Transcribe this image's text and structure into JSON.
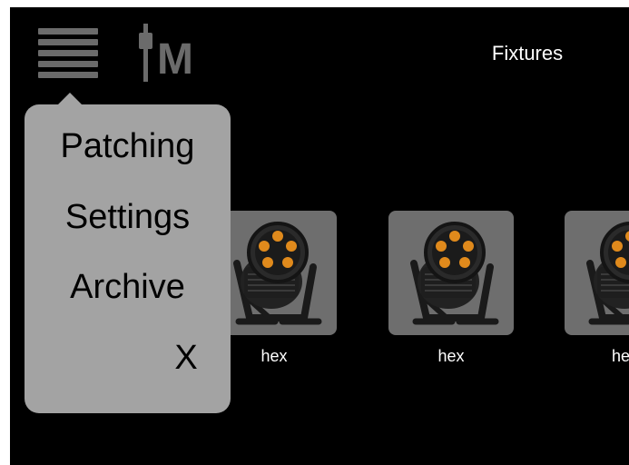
{
  "header": {
    "title": "Fixtures",
    "menu_icon": "hamburger-menu-icon",
    "logo_icon": "fader-m-logo",
    "logo_letter": "M"
  },
  "fixtures": [
    {
      "label": "hex",
      "icon": "par-light-fixture"
    },
    {
      "label": "hex",
      "icon": "par-light-fixture"
    },
    {
      "label": "he",
      "icon": "par-light-fixture"
    }
  ],
  "menu": {
    "items": [
      {
        "label": "Patching"
      },
      {
        "label": "Settings"
      },
      {
        "label": "Archive"
      }
    ],
    "close_label": "X"
  },
  "colors": {
    "background": "#000000",
    "menu_background": "#a3a3a3",
    "thumb_background": "#6e6e6e",
    "icon_gray": "#6b6b6b",
    "led_amber": "#e08a1c"
  }
}
